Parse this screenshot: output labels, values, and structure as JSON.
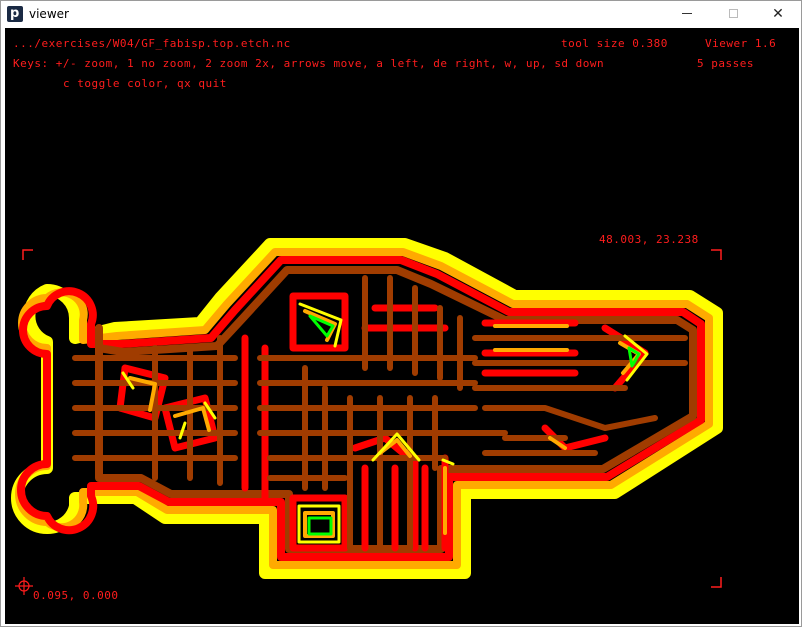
{
  "window": {
    "title": "viewer",
    "icon": "p-logo-icon"
  },
  "hud": {
    "file_path": ".../exercises/W04/GF_fabisp.top.etch.nc",
    "tool_size": "tool size 0.380",
    "version": "Viewer 1.6",
    "keys_line1": "Keys: +/- zoom, 1 no zoom, 2 zoom 2x, arrows move, a left, de right, w, up, sd down",
    "passes": "5 passes",
    "keys_line2": "c toggle color, qx quit",
    "coord_top_right": "48.003,  23.238",
    "coord_bottom_left": "0.095,  0.000"
  },
  "colors": {
    "background": "#000000",
    "hud_text": "#ff1d1d",
    "pass1": "#ffff00",
    "pass2": "#ffaa00",
    "pass3": "#ff0000",
    "pass4": "#a03c00",
    "pass5": "#00ff00"
  }
}
